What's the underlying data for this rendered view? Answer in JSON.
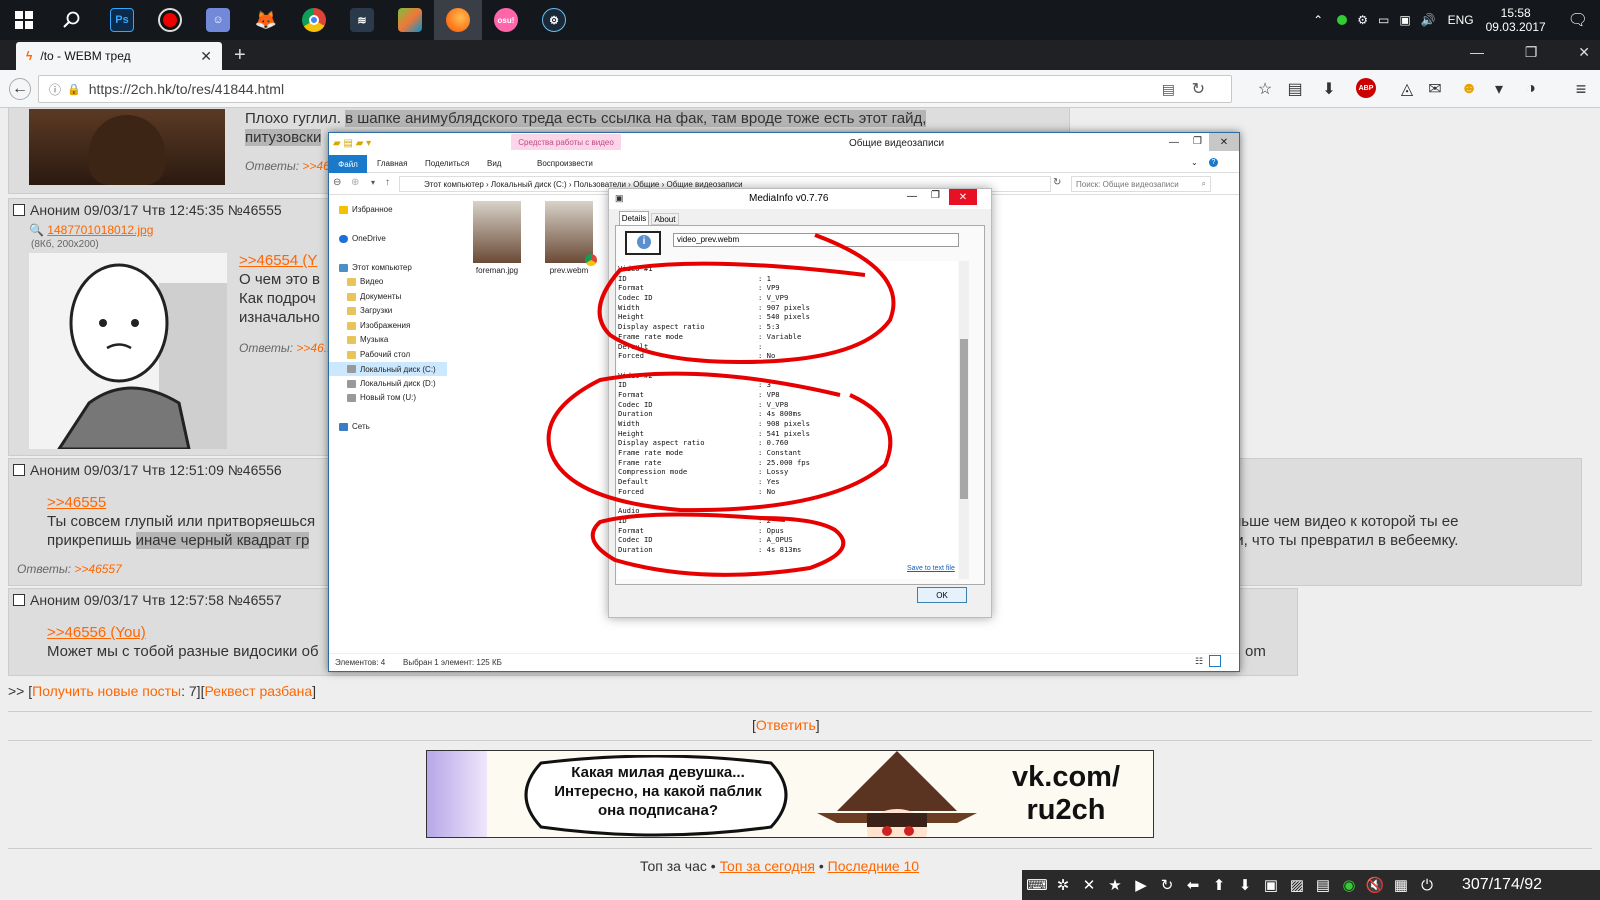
{
  "taskbar": {
    "apps": [
      {
        "icon": "windows-start-icon"
      },
      {
        "icon": "search-icon"
      },
      {
        "icon": "photoshop-icon",
        "label": "Ps"
      },
      {
        "icon": "record-icon"
      },
      {
        "icon": "discord-icon"
      },
      {
        "icon": "fox-icon"
      },
      {
        "icon": "chrome-icon"
      },
      {
        "icon": "app-icon"
      },
      {
        "icon": "bluestacks-icon"
      },
      {
        "icon": "firefox-icon"
      },
      {
        "icon": "osu-icon",
        "label": "osu!"
      },
      {
        "icon": "steam-icon"
      }
    ],
    "lang": "ENG",
    "time": "15:58",
    "date": "09.03.2017"
  },
  "browser": {
    "tab_title": "/to - WEBM тред",
    "url": "https://2ch.hk/to/res/41844.html",
    "window_controls": [
      "—",
      "❐",
      "✕"
    ]
  },
  "posts": {
    "p0": {
      "text_plain": "Плохо гуглил. ",
      "text_hl1": "в шапке анимублядского треда есть ссылка на фак, там вроде тоже есть этот гайд,",
      "text_hl2": "питузовски",
      "answers_label": "Ответы:",
      "answers_ref": ">>46..."
    },
    "p1": {
      "header": "Аноним 09/03/17 Чтв 12:45:35  №46555",
      "file": "1487701018012.jpg",
      "file_meta": "(8Кб, 200x200)",
      "ref": ">>46554 (Y",
      "line1": "О чем это в",
      "line2": "Как подроч",
      "line3": "изначально",
      "answers_label": "Ответы:",
      "answers_ref": ">>46..."
    },
    "p2": {
      "header": "Аноним 09/03/17 Чтв 12:51:09  №46556",
      "ref": ">>46555",
      "line1_a": "Ты совсем глупый или притворяешься",
      "line1_b": "ньше чем видео к которой ты ее",
      "line2_a": "прикрепишь ",
      "line2_hl": "иначе черный квадрат гр",
      "line2_b": "и, что ты превратил в вебеемку.",
      "answers_label": "Ответы:",
      "answers_ref": ">>46557"
    },
    "p3": {
      "header": "Аноним 09/03/17 Чтв 12:57:58  №46557",
      "ref": ">>46556 (You)",
      "line1": "Может мы с тобой разные видосики об",
      "line1_tail": "om"
    }
  },
  "footer": {
    "prefix": ">> [",
    "new_posts": "Получить новые посты",
    "new_count": ": 7][",
    "request": "Реквест разбана",
    "suffix": "]",
    "reply": "Ответить",
    "top_hour": "Топ за час",
    "top_today": "Топ за сегодня",
    "latest": "Последние 10"
  },
  "banner": {
    "bubble1": "Какая милая девушка...",
    "bubble2": "Интересно, на какой паблик",
    "bubble3": "она подписана?",
    "vk1": "vk.com/",
    "vk2": "ru2ch"
  },
  "explorer": {
    "title": "Общие видеозаписи",
    "contextual_tab": "Средства работы с видео",
    "ribbon_tabs": [
      "Файл",
      "Главная",
      "Поделиться",
      "Вид",
      "Воспроизвести"
    ],
    "breadcrumb": "Этот компьютер  ›  Локальный диск (C:)  ›  Пользователи  ›  Общие  ›  Общие видеозаписи",
    "search_placeholder": "Поиск: Общие видеозаписи",
    "tree": [
      "Избранное",
      "OneDrive",
      "Этот компьютер",
      "Видео",
      "Документы",
      "Загрузки",
      "Изображения",
      "Музыка",
      "Рабочий стол",
      "Локальный диск (C:)",
      "Локальный диск (D:)",
      "Новый том (U:)",
      "Сеть"
    ],
    "files": [
      {
        "name": "foreman.jpg"
      },
      {
        "name": "prev.webm"
      }
    ],
    "status_count": "Элементов: 4",
    "status_selected": "Выбран 1 элемент: 125 КБ"
  },
  "mediainfo": {
    "title": "MediaInfo v0.7.76",
    "tabs": [
      "Details",
      "About"
    ],
    "filename": "video_prev.webm",
    "save_link": "Save to text file",
    "ok": "OK",
    "rows": [
      [
        "Video #1",
        ""
      ],
      [
        "ID",
        "1"
      ],
      [
        "Format",
        "VP9"
      ],
      [
        "Codec ID",
        "V_VP9"
      ],
      [
        "Width",
        "907 pixels"
      ],
      [
        "Height",
        "540 pixels"
      ],
      [
        "Display aspect ratio",
        "5:3"
      ],
      [
        "Frame rate mode",
        "Variable"
      ],
      [
        "Default",
        ""
      ],
      [
        "Forced",
        "No"
      ],
      [
        "",
        ""
      ],
      [
        "Video #2",
        ""
      ],
      [
        "ID",
        "3"
      ],
      [
        "Format",
        "VP8"
      ],
      [
        "Codec ID",
        "V_VP8"
      ],
      [
        "Duration",
        "4s 800ms"
      ],
      [
        "Width",
        "908 pixels"
      ],
      [
        "Height",
        "541 pixels"
      ],
      [
        "Display aspect ratio",
        "0.760"
      ],
      [
        "Frame rate mode",
        "Constant"
      ],
      [
        "Frame rate",
        "25.000 fps"
      ],
      [
        "Compression mode",
        "Lossy"
      ],
      [
        "Default",
        "Yes"
      ],
      [
        "Forced",
        "No"
      ],
      [
        "",
        ""
      ],
      [
        "Audio",
        ""
      ],
      [
        "ID",
        "2"
      ],
      [
        "Format",
        "Opus"
      ],
      [
        "Codec ID",
        "A_OPUS"
      ],
      [
        "Duration",
        "4s 813ms"
      ]
    ]
  },
  "osk": {
    "counter": "307/174/92"
  },
  "colors": {
    "link": "#ff6600",
    "annotation": "#e60000",
    "explorer_accent": "#1979ca"
  }
}
